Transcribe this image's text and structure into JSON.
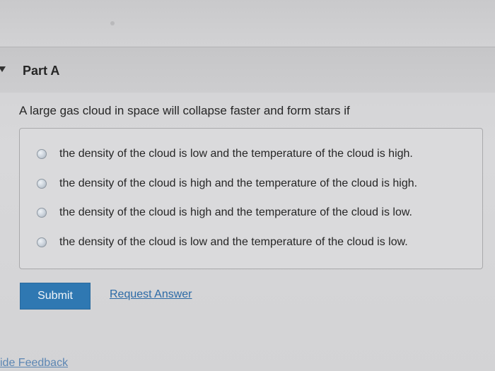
{
  "part": {
    "title": "Part A"
  },
  "question": {
    "text": "A large gas cloud in space will collapse faster and form stars if"
  },
  "options": [
    {
      "label": "the density of the cloud is low and the temperature of the cloud is high."
    },
    {
      "label": "the density of the cloud is high and the temperature of the cloud is high."
    },
    {
      "label": "the density of the cloud is high and the temperature of the cloud is low."
    },
    {
      "label": "the density of the cloud is low and the temperature of the cloud is low."
    }
  ],
  "actions": {
    "submit_label": "Submit",
    "request_answer_label": "Request Answer"
  },
  "footer": {
    "feedback_label": "vide Feedback"
  },
  "colors": {
    "submit_button": "#2f78b2",
    "link": "#2c6aa6"
  }
}
